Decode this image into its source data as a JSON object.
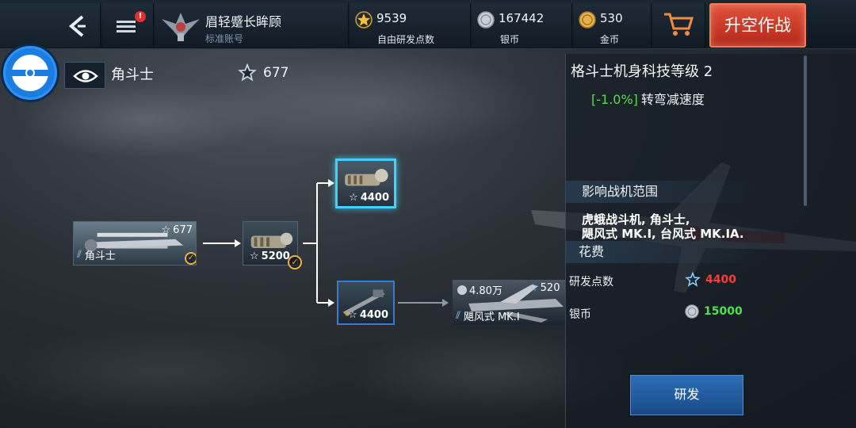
{
  "header": {
    "rank_title": "眉轻蹙长眸顾",
    "account_type": "标准账号",
    "notification_badge": "!",
    "resources": [
      {
        "icon": "star-icon",
        "value": "9539",
        "label": "自由研发点数"
      },
      {
        "icon": "silver-coin-icon",
        "value": "167442",
        "label": "银币"
      },
      {
        "icon": "gold-coin-icon",
        "value": "530",
        "label": "金币"
      }
    ],
    "fly_button": "升空作战"
  },
  "subheader": {
    "aircraft_name": "角斗士",
    "research_points": "677"
  },
  "tree": {
    "plane": {
      "name": "角斗士",
      "rp": "677"
    },
    "mod1": {
      "cost": "5200"
    },
    "mod_selected": {
      "cost": "4400"
    },
    "mod_gun": {
      "cost": "4400"
    },
    "next_plane": {
      "cost": "4.80万",
      "rp": "520",
      "name": "飓风式 MK.I"
    }
  },
  "panel": {
    "title": "格斗士机身科技等级 2",
    "effect_pct": "[-1.0%]",
    "effect_text": "转弯减速度",
    "range_header": "影响战机范围",
    "range_line1": "虎蛾战斗机, 角斗士,",
    "range_line2": "飓风式 MK.I, 台风式 MK.IA.",
    "cost_header": "花费",
    "rp_label": "研发点数",
    "rp_value": "4400",
    "silver_label": "银币",
    "silver_value": "15000",
    "research_button": "研发"
  },
  "colors": {
    "accent_blue": "#43d2ff",
    "fly_button": "#d2402c",
    "cost_insufficient": "#ff3b3b",
    "cost_ok": "#4fe04f",
    "effect_green": "#4fe04f"
  }
}
